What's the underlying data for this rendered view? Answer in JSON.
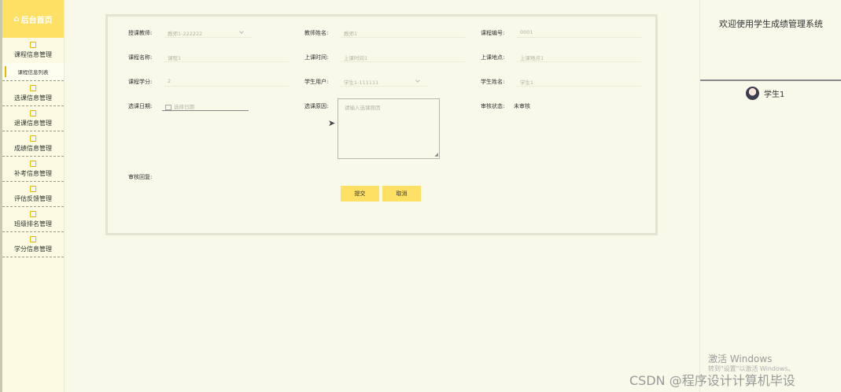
{
  "sidebar": {
    "home_label": "后台首页",
    "items": [
      {
        "label": "课程信息管理",
        "sub": "课程信息列表"
      },
      {
        "label": "选课信息管理"
      },
      {
        "label": "退课信息管理"
      },
      {
        "label": "成绩信息管理"
      },
      {
        "label": "补考信息管理"
      },
      {
        "label": "评估反馈管理"
      },
      {
        "label": "班级排名管理"
      },
      {
        "label": "学分信息管理"
      }
    ]
  },
  "form": {
    "teacher_label": "授课教师:",
    "teacher_value": "教师1-222222",
    "teacher_name_label": "教师姓名:",
    "teacher_name_value": "教师1",
    "course_no_label": "课程编号:",
    "course_no_value": "0001",
    "course_name_label": "课程名称:",
    "course_name_value": "课程1",
    "class_time_label": "上课时间:",
    "class_time_value": "上课时间1",
    "class_place_label": "上课地点:",
    "class_place_value": "上课地点1",
    "credit_label": "课程学分:",
    "credit_value": "2",
    "student_user_label": "学生用户:",
    "student_user_value": "学生1-111111",
    "student_name_label": "学生姓名:",
    "student_name_value": "学生1",
    "select_date_label": "选课日期:",
    "select_date_placeholder": "选择日期",
    "reason_label": "选课原因:",
    "reason_placeholder": "请输入选课原因",
    "audit_status_label": "审核状态:",
    "audit_status_value": "未审核",
    "audit_reply_label": "审核回复:",
    "submit_label": "提交",
    "cancel_label": "取消"
  },
  "header": {
    "welcome": "欢迎使用学生成绩管理系统",
    "username": "学生1"
  },
  "overlay": {
    "windows_activate": "激活 Windows",
    "windows_activate_sub": "转到\"设置\"以激活 Windows。",
    "csdn": "CSDN @程序设计计算机毕设"
  },
  "colors": {
    "accent": "#fde064",
    "background": "#f8f9e8"
  }
}
